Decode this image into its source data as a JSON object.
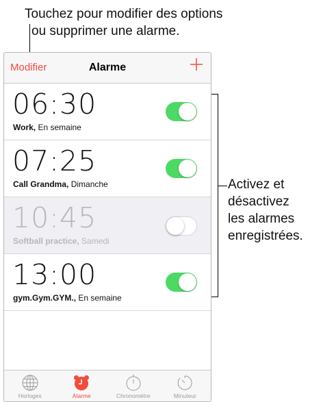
{
  "callout_top": {
    "line1": "Touchez pour modifier des options",
    "line2": "ou supprimer une alarme."
  },
  "callout_right": {
    "line1": "Activez et",
    "line2": "désactivez",
    "line3": "les alarmes",
    "line4": "enregistrées."
  },
  "navbar": {
    "edit_label": "Modifier",
    "title": "Alarme",
    "add_label": "+"
  },
  "alarms": [
    {
      "time": "06:30",
      "name": "Work,",
      "repeat": " En semaine",
      "enabled": true
    },
    {
      "time": "07:25",
      "name": "Call Grandma,",
      "repeat": " Dimanche",
      "enabled": true
    },
    {
      "time": "10:45",
      "name": "Softball practice,",
      "repeat": " Samedi",
      "enabled": false
    },
    {
      "time": "13:00",
      "name": "gym.Gym.GYM.,",
      "repeat": " En semaine",
      "enabled": true
    }
  ],
  "tabbar": {
    "tabs": [
      {
        "label": "Horloges",
        "icon": "globe-icon",
        "active": false
      },
      {
        "label": "Alarme",
        "icon": "alarm-clock-icon",
        "active": true
      },
      {
        "label": "Chronomètre",
        "icon": "stopwatch-icon",
        "active": false
      },
      {
        "label": "Minuteur",
        "icon": "timer-icon",
        "active": false
      }
    ]
  },
  "colors": {
    "accent": "#f24b3c",
    "toggle_on": "#4cd964",
    "disabled_row": "#efeff4"
  }
}
